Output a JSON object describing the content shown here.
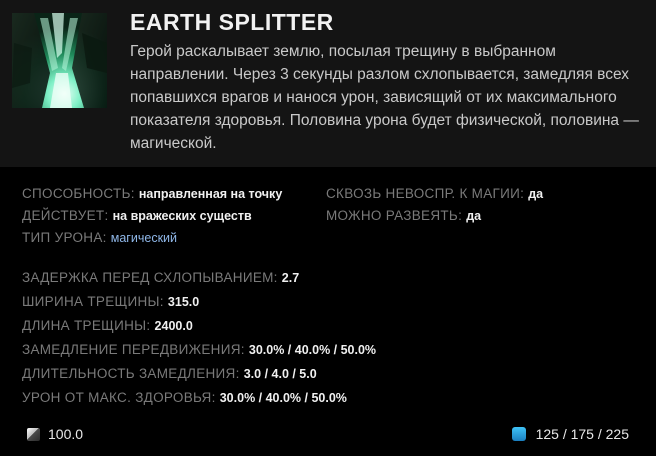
{
  "ability": {
    "title": "EARTH SPLITTER",
    "description": "Герой раскалывает землю, посылая трещину в выбранном направлении. Через 3 секунды разлом схлопывается, замедляя всех попавшихся врагов и нанося урон, зависящий от их максимального показателя здоровья. Половина урона будет физической, половина — магической.",
    "icon": "earth-splitter-ability-icon"
  },
  "attributes": {
    "ability_label": "СПОСОБНОСТЬ:",
    "ability_value": "направленная на точку",
    "affects_label": "ДЕЙСТВУЕТ:",
    "affects_value": "на вражеских существ",
    "damage_type_label": "ТИП УРОНА:",
    "damage_type_value": "магический",
    "spell_immunity_label": "СКВОЗЬ НЕВОСПР. К МАГИИ:",
    "spell_immunity_value": "да",
    "dispellable_label": "МОЖНО РАЗВЕЯТЬ:",
    "dispellable_value": "да"
  },
  "stats": [
    {
      "label": "ЗАДЕРЖКА ПЕРЕД СХЛОПЫВАНИЕМ:",
      "value": "2.7"
    },
    {
      "label": "ШИРИНА ТРЕЩИНЫ:",
      "value": "315.0"
    },
    {
      "label": "ДЛИНА ТРЕЩИНЫ:",
      "value": "2400.0"
    },
    {
      "label": "ЗАМЕДЛЕНИЕ ПЕРЕДВИЖЕНИЯ:",
      "value": "30.0% / 40.0% / 50.0%"
    },
    {
      "label": "ДЛИТЕЛЬНОСТЬ ЗАМЕДЛЕНИЯ:",
      "value": "3.0 / 4.0 / 5.0"
    },
    {
      "label": "УРОН ОТ МАКС. ЗДОРОВЬЯ:",
      "value": "30.0% / 40.0% / 50.0%"
    }
  ],
  "footer": {
    "cooldown": "100.0",
    "cooldown_icon": "cooldown-icon",
    "mana_cost": "125 / 175 / 225",
    "mana_icon": "mana-icon"
  },
  "colors": {
    "background": "#000000",
    "header_background": "#141414",
    "label": "#7a7a7a",
    "value": "#f0f0f0",
    "magic_damage": "#8fb7e8",
    "mana": "#1f9ad8"
  }
}
